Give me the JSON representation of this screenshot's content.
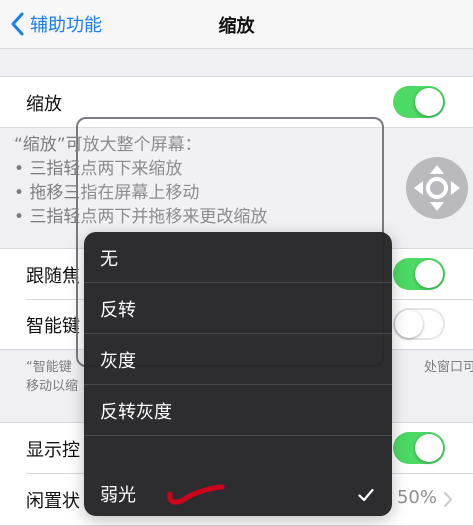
{
  "nav": {
    "back_label": "辅助功能",
    "title": "缩放"
  },
  "zoom_row": {
    "label": "缩放",
    "enabled": true
  },
  "description": {
    "heading": "“缩放”可放大整个屏幕：",
    "items": [
      "三指轻点两下来缩放",
      "拖移三指在屏幕上移动",
      "三指轻点两下并拖移来更改缩放"
    ]
  },
  "rows": {
    "follow_focus": {
      "label": "跟随焦",
      "enabled": true
    },
    "smart_keyboard": {
      "label": "智能键",
      "enabled": false
    },
    "footnote": {
      "left_line1": "“智能键",
      "left_line2": "移动以缩",
      "right_line1": "处窗口可"
    },
    "show_controller": {
      "label": "显示控",
      "enabled": true
    },
    "idle_visibility": {
      "label": "闲置状",
      "value": "50%"
    }
  },
  "filter_menu": {
    "options": [
      "无",
      "反转",
      "灰度",
      "反转灰度",
      "弱光"
    ],
    "selected": "弱光"
  },
  "colors": {
    "accent": "#1a7cf6",
    "toggle_on": "#4cd964",
    "annotation": "#d0021b"
  },
  "icons": [
    "chevron-left-icon",
    "dpad-icon",
    "checkmark-icon",
    "chevron-right-icon"
  ]
}
